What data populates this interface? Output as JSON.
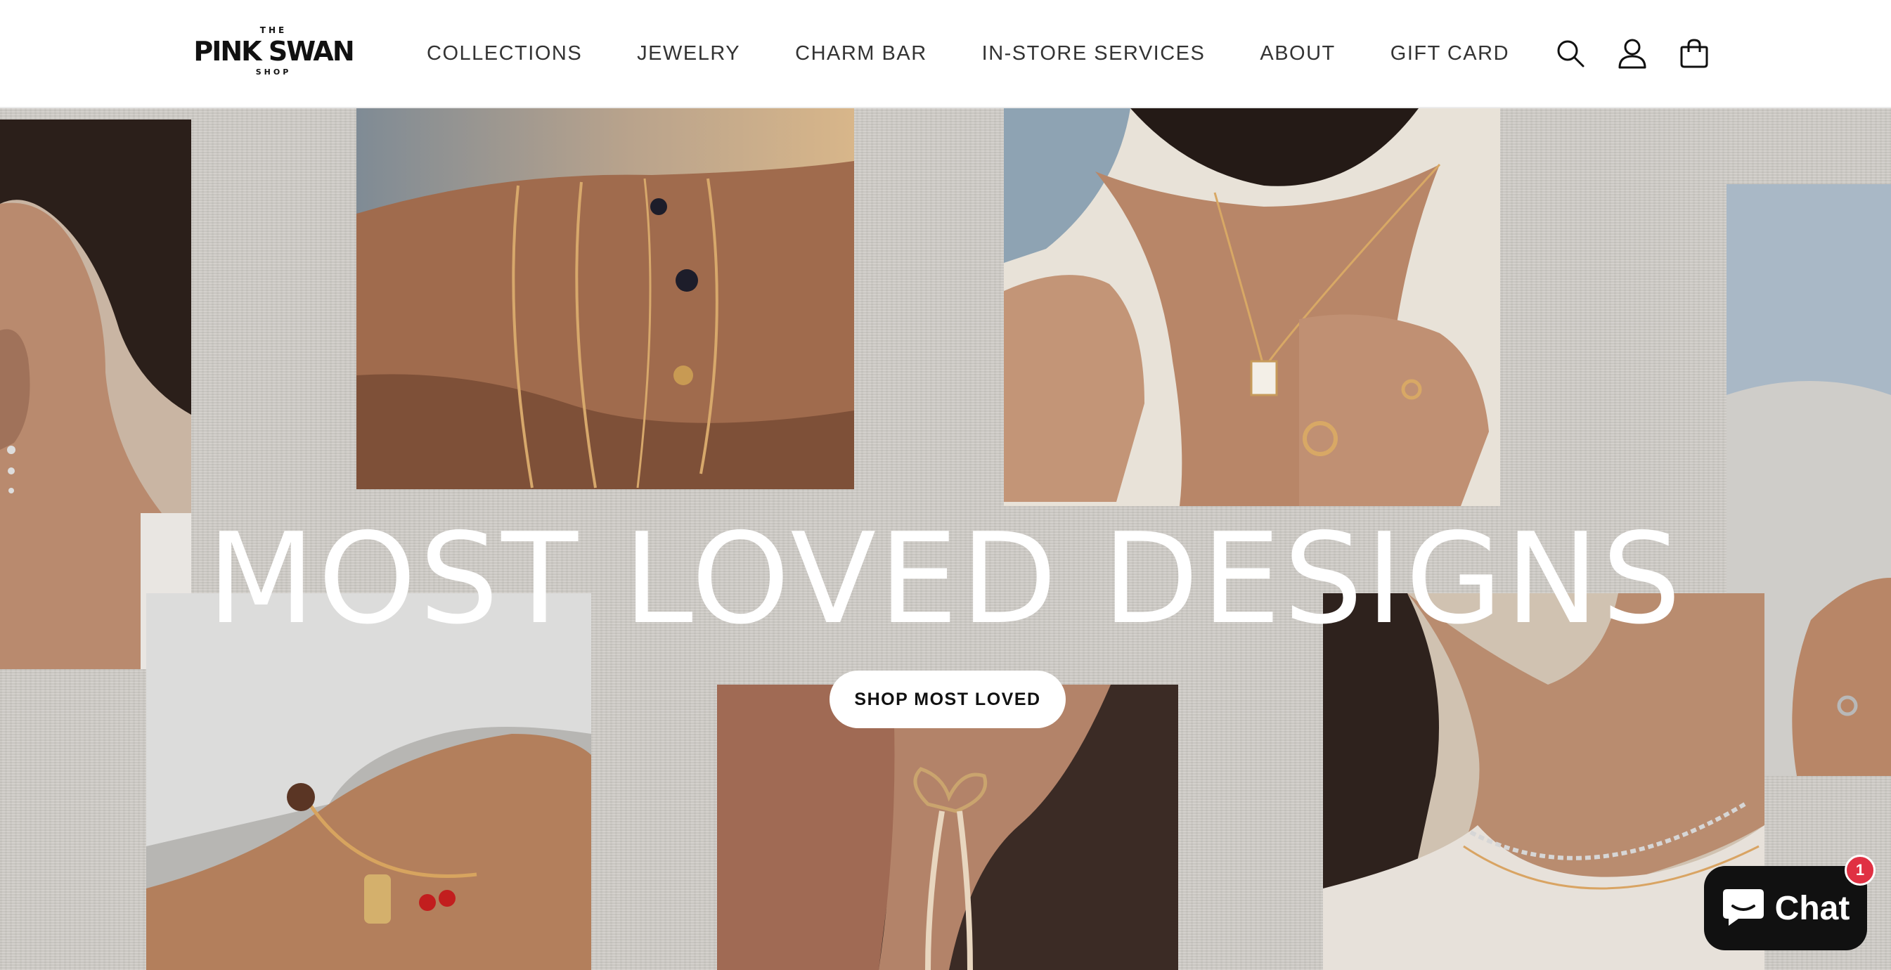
{
  "brand": {
    "the": "THE",
    "name": "PINK SWAN",
    "shop": "SHOP"
  },
  "nav": {
    "items": [
      {
        "label": "COLLECTIONS"
      },
      {
        "label": "JEWELRY"
      },
      {
        "label": "CHARM BAR"
      },
      {
        "label": "IN-STORE SERVICES"
      },
      {
        "label": "ABOUT"
      },
      {
        "label": "GIFT CARD"
      }
    ]
  },
  "header_icons": [
    "search-icon",
    "account-icon",
    "cart-icon"
  ],
  "hero": {
    "title": "MOST LOVED DESIGNS",
    "cta_label": "SHOP MOST LOVED",
    "background_color": "#cfccc7"
  },
  "chat": {
    "label": "Chat",
    "badge_count": "1",
    "button_color": "#111111",
    "badge_color": "#e03043"
  }
}
